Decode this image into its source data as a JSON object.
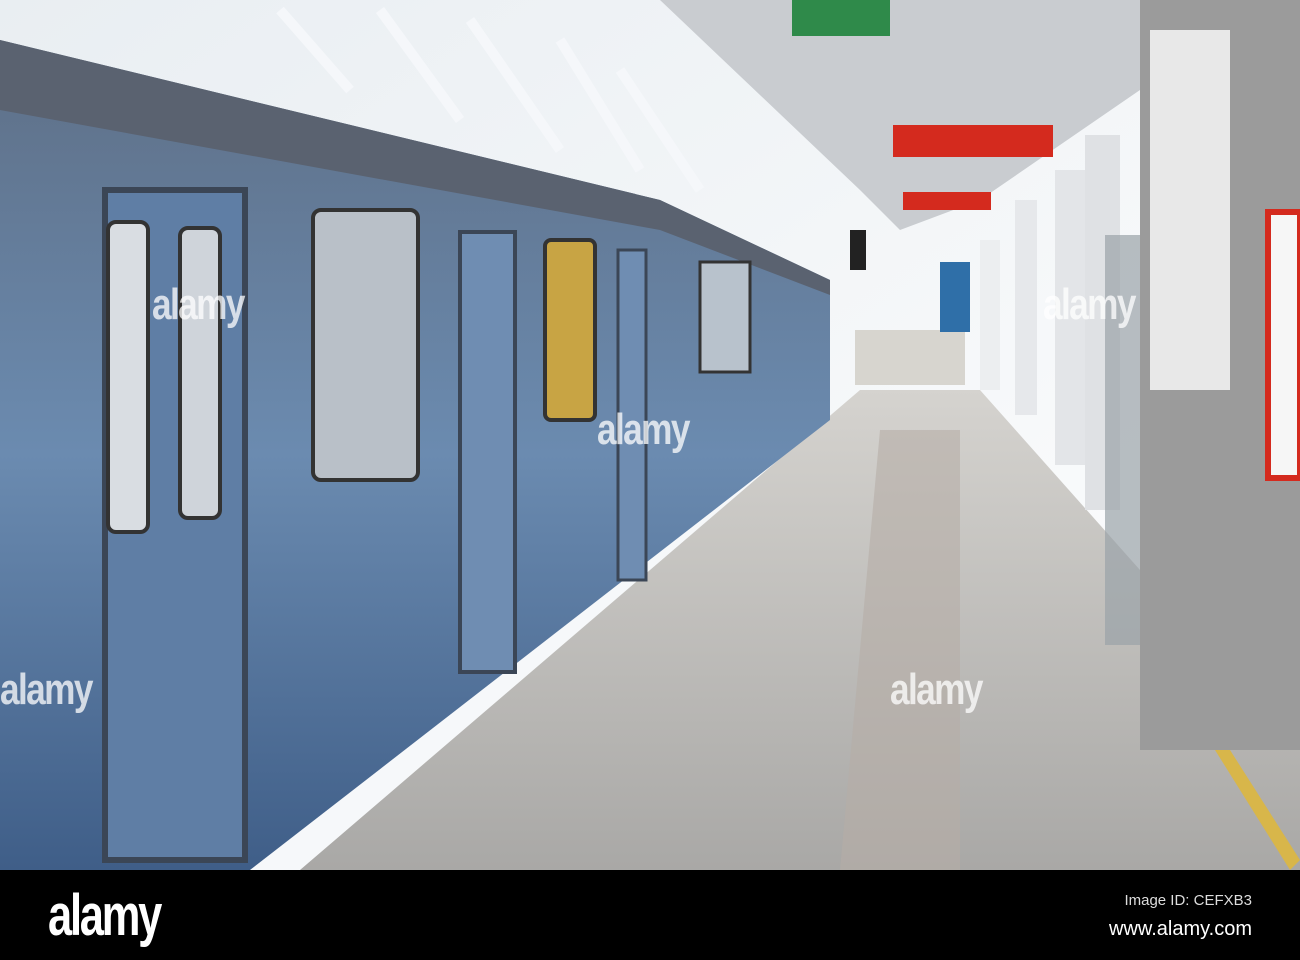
{
  "watermark": "alamy",
  "footer": {
    "logo": "alamy",
    "image_id": "Image ID: CEFXB3",
    "url": "www.alamy.com"
  },
  "colors": {
    "train": "#6f8db0",
    "platform": "#b9b7b4",
    "sign": "#d42a1e",
    "bar": "#000000"
  }
}
